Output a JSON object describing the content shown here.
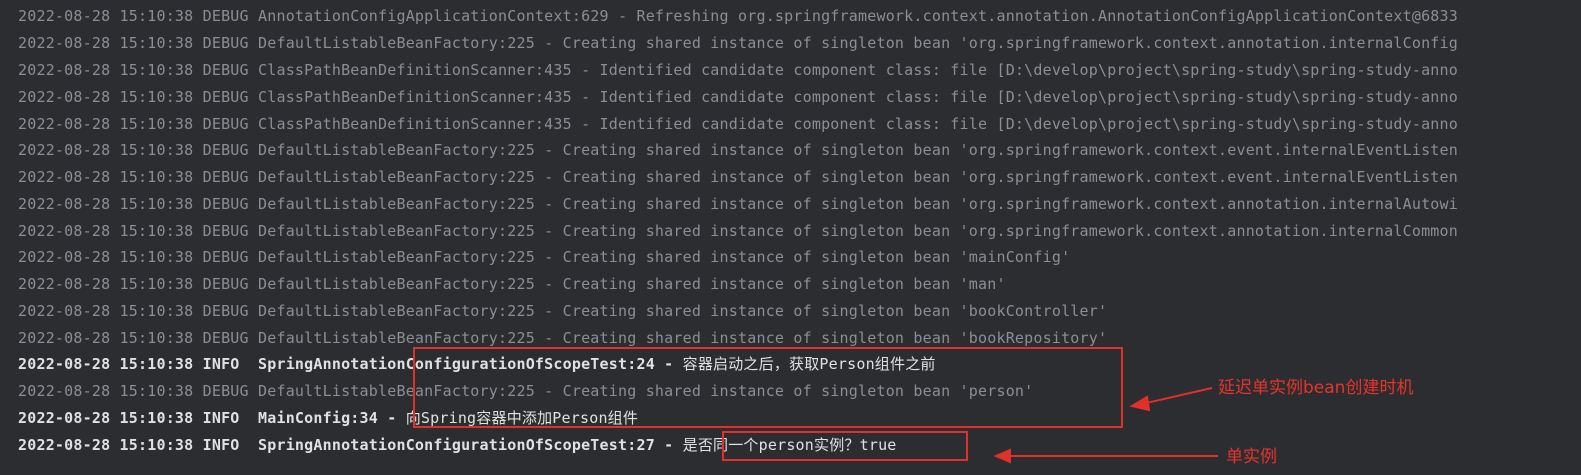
{
  "console": {
    "lines": [
      {
        "level": "debug",
        "text": "2022-08-28 15:10:38 DEBUG AnnotationConfigApplicationContext:629 - Refreshing org.springframework.context.annotation.AnnotationConfigApplicationContext@6833"
      },
      {
        "level": "debug",
        "text": "2022-08-28 15:10:38 DEBUG DefaultListableBeanFactory:225 - Creating shared instance of singleton bean 'org.springframework.context.annotation.internalConfig"
      },
      {
        "level": "debug",
        "text": "2022-08-28 15:10:38 DEBUG ClassPathBeanDefinitionScanner:435 - Identified candidate component class: file [D:\\develop\\project\\spring-study\\spring-study-anno"
      },
      {
        "level": "debug",
        "text": "2022-08-28 15:10:38 DEBUG ClassPathBeanDefinitionScanner:435 - Identified candidate component class: file [D:\\develop\\project\\spring-study\\spring-study-anno"
      },
      {
        "level": "debug",
        "text": "2022-08-28 15:10:38 DEBUG ClassPathBeanDefinitionScanner:435 - Identified candidate component class: file [D:\\develop\\project\\spring-study\\spring-study-anno"
      },
      {
        "level": "debug",
        "text": "2022-08-28 15:10:38 DEBUG DefaultListableBeanFactory:225 - Creating shared instance of singleton bean 'org.springframework.context.event.internalEventListen"
      },
      {
        "level": "debug",
        "text": "2022-08-28 15:10:38 DEBUG DefaultListableBeanFactory:225 - Creating shared instance of singleton bean 'org.springframework.context.event.internalEventListen"
      },
      {
        "level": "debug",
        "text": "2022-08-28 15:10:38 DEBUG DefaultListableBeanFactory:225 - Creating shared instance of singleton bean 'org.springframework.context.annotation.internalAutowi"
      },
      {
        "level": "debug",
        "text": "2022-08-28 15:10:38 DEBUG DefaultListableBeanFactory:225 - Creating shared instance of singleton bean 'org.springframework.context.annotation.internalCommon"
      },
      {
        "level": "debug",
        "text": "2022-08-28 15:10:38 DEBUG DefaultListableBeanFactory:225 - Creating shared instance of singleton bean 'mainConfig'"
      },
      {
        "level": "debug",
        "text": "2022-08-28 15:10:38 DEBUG DefaultListableBeanFactory:225 - Creating shared instance of singleton bean 'man'"
      },
      {
        "level": "debug",
        "text": "2022-08-28 15:10:38 DEBUG DefaultListableBeanFactory:225 - Creating shared instance of singleton bean 'bookController'"
      },
      {
        "level": "debug",
        "text": "2022-08-28 15:10:38 DEBUG DefaultListableBeanFactory:225 - Creating shared instance of singleton bean 'bookRepository'"
      },
      {
        "level": "info",
        "prefix": "2022-08-28 15:10:38 INFO  SpringAnnotationConfigurationOfScopeTest:24 - ",
        "msg": "容器启动之后，获取Person组件之前"
      },
      {
        "level": "debug",
        "text": "2022-08-28 15:10:38 DEBUG DefaultListableBeanFactory:225 - Creating shared instance of singleton bean 'person'"
      },
      {
        "level": "info",
        "prefix": "2022-08-28 15:10:38 INFO  MainConfig:34 - ",
        "msg": "向Spring容器中添加Person组件"
      },
      {
        "level": "info",
        "prefix": "2022-08-28 15:10:38 INFO  SpringAnnotationConfigurationOfScopeTest:27 - ",
        "msg": "是否同一个person实例？true"
      }
    ]
  },
  "annotations": {
    "lazy_note": "延迟单实例bean创建时机",
    "singleton_note": "单实例",
    "color": "#e0302a"
  }
}
